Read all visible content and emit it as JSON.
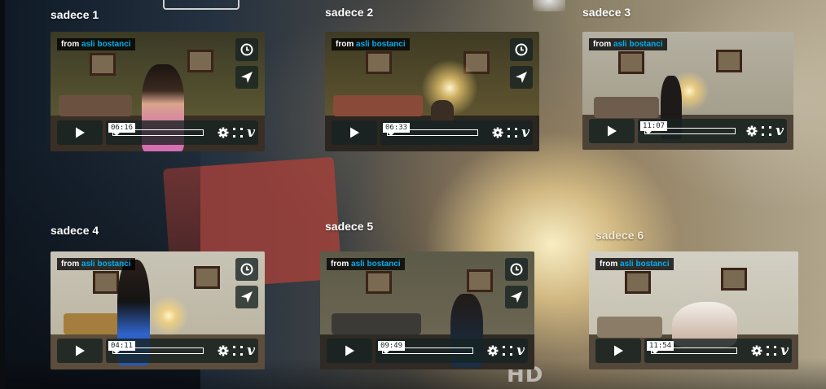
{
  "background": {
    "watermark": "HD"
  },
  "cards": [
    {
      "title": "sadece 1",
      "from_label": "from",
      "author": "asli bostanci",
      "time": "06:16"
    },
    {
      "title": "sadece 2",
      "from_label": "from",
      "author": "asli bostanci",
      "time": "06:33"
    },
    {
      "title": "sadece 3",
      "from_label": "from",
      "author": "asli bostanci",
      "time": "11:07"
    },
    {
      "title": "sadece 4",
      "from_label": "from",
      "author": "asli bostanci",
      "time": "04:11"
    },
    {
      "title": "sadece 5",
      "from_label": "from",
      "author": "asli bostanci",
      "time": "09:49"
    },
    {
      "title": "sadece 6",
      "from_label": "from",
      "author": "asli bostanci",
      "time": "11:54"
    }
  ],
  "icons": {
    "watch_later": "clock-icon",
    "share": "paper-plane-icon",
    "play": "play-icon",
    "settings": "gear-icon",
    "fullscreen": "fullscreen-icon",
    "brand": "vimeo-logo-icon"
  },
  "colors": {
    "accent": "#00adef",
    "control_bg": "#172322"
  }
}
